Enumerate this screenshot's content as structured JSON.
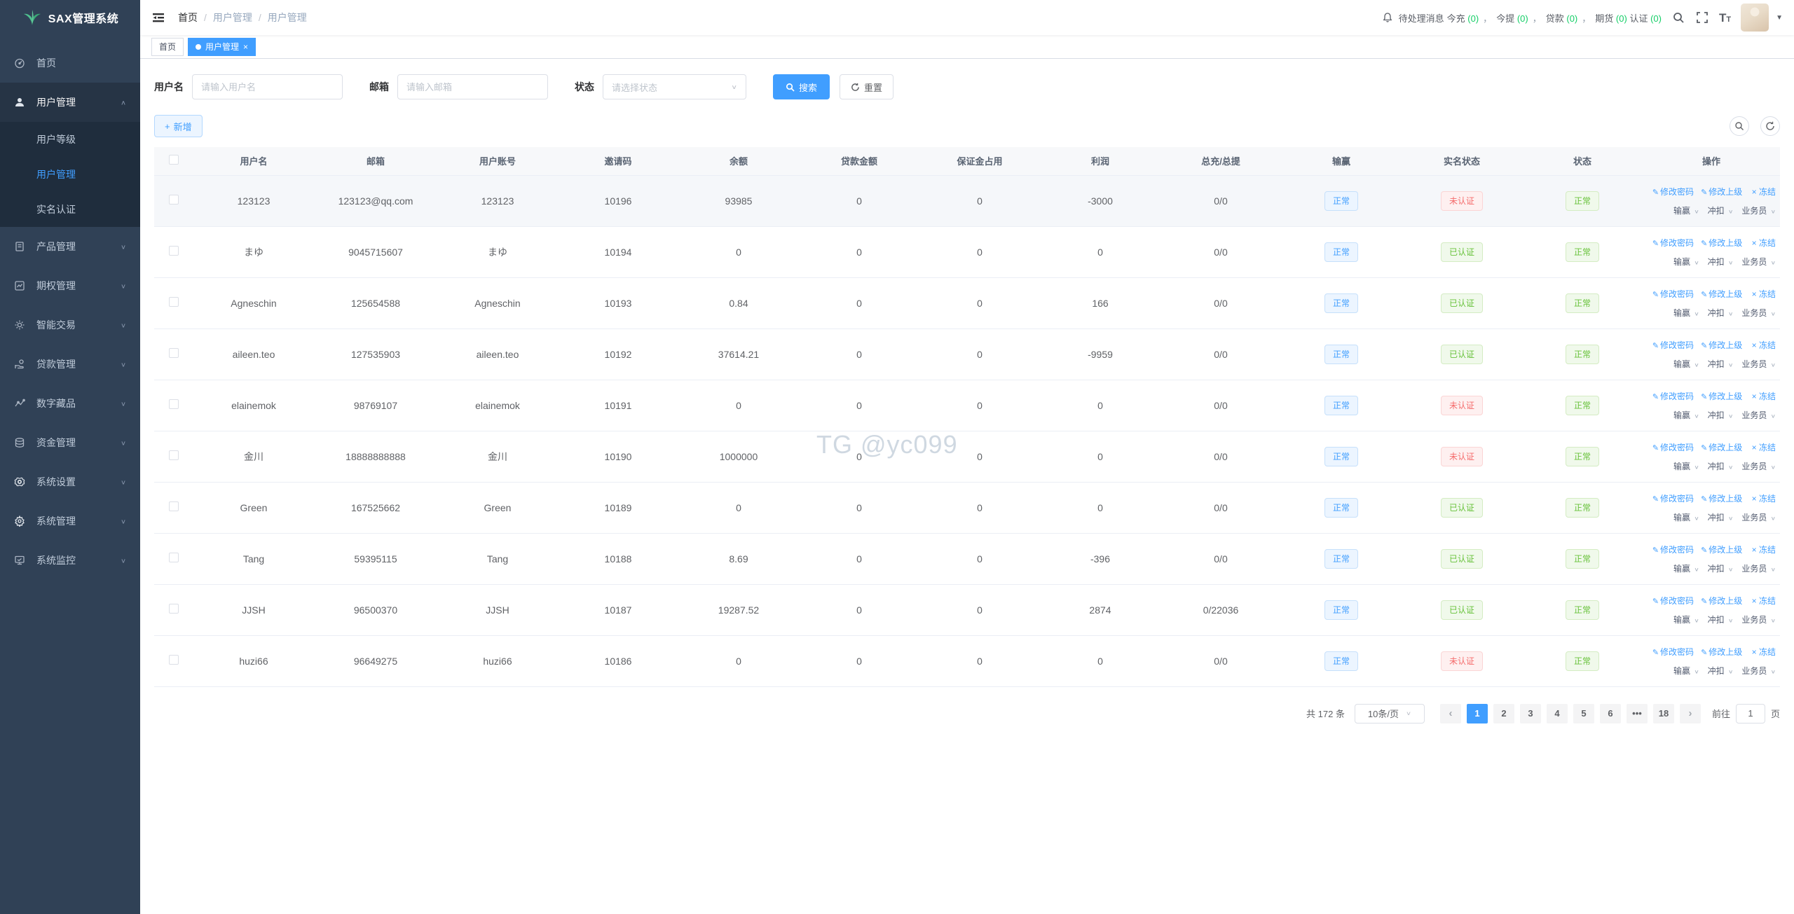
{
  "colors": {
    "accent": "#409eff",
    "success": "#67c23a",
    "count_green": "#13ce66",
    "danger": "#f56c6c",
    "sidebar_bg": "#304156",
    "submenu_bg": "#1f2d3d"
  },
  "app": {
    "logo_title": "SAX管理系统"
  },
  "sidebar": {
    "items": [
      {
        "label": "首页",
        "icon": "dashboard-icon"
      },
      {
        "label": "用户管理",
        "icon": "user-icon",
        "expanded": true,
        "children": [
          {
            "label": "用户等级"
          },
          {
            "label": "用户管理",
            "active": true
          },
          {
            "label": "实名认证"
          }
        ]
      },
      {
        "label": "产品管理",
        "icon": "product-icon"
      },
      {
        "label": "期权管理",
        "icon": "options-icon"
      },
      {
        "label": "智能交易",
        "icon": "smart-trade-icon"
      },
      {
        "label": "贷款管理",
        "icon": "loan-icon"
      },
      {
        "label": "数字藏品",
        "icon": "nft-icon"
      },
      {
        "label": "资金管理",
        "icon": "funds-icon"
      },
      {
        "label": "系统设置",
        "icon": "settings-icon"
      },
      {
        "label": "系统管理",
        "icon": "system-icon"
      },
      {
        "label": "系统监控",
        "icon": "monitor-icon"
      }
    ]
  },
  "header": {
    "breadcrumb": [
      "首页",
      "用户管理",
      "用户管理"
    ],
    "messages": {
      "prefix": "待处理消息",
      "items": [
        {
          "label": "今充",
          "count": "(0)",
          "sep": "，"
        },
        {
          "label": "今提",
          "count": "(0)",
          "sep": "，"
        },
        {
          "label": "贷款",
          "count": "(0)",
          "sep": "，"
        },
        {
          "label": "期货",
          "count": "(0)",
          "sep": ""
        },
        {
          "label": "认证",
          "count": "(0)",
          "sep": ""
        }
      ]
    }
  },
  "tabs": [
    {
      "label": "首页",
      "active": false,
      "closable": false
    },
    {
      "label": "用户管理",
      "active": true,
      "closable": true
    }
  ],
  "filters": {
    "username": {
      "label": "用户名",
      "placeholder": "请输入用户名",
      "value": ""
    },
    "email": {
      "label": "邮箱",
      "placeholder": "请输入邮箱",
      "value": ""
    },
    "status": {
      "label": "状态",
      "placeholder": "请选择状态"
    },
    "search_label": "搜索",
    "reset_label": "重置"
  },
  "toolbar": {
    "add_label": "新增"
  },
  "table": {
    "columns": [
      "用户名",
      "邮箱",
      "用户账号",
      "邀请码",
      "余额",
      "贷款金额",
      "保证金占用",
      "利润",
      "总充/总提",
      "输赢",
      "实名状态",
      "状态",
      "操作"
    ],
    "rows": [
      {
        "username": "123123",
        "email": "123123@qq.com",
        "account": "123123",
        "invite": "10196",
        "balance": "93985",
        "loan": "0",
        "margin": "0",
        "profit": "-3000",
        "total": "0/0",
        "winlose": "正常",
        "realname": "未认证",
        "realname_state": "danger",
        "status": "正常",
        "highlighted": true
      },
      {
        "username": "まゆ",
        "email": "9045715607",
        "account": "まゆ",
        "invite": "10194",
        "balance": "0",
        "loan": "0",
        "margin": "0",
        "profit": "0",
        "total": "0/0",
        "winlose": "正常",
        "realname": "已认证",
        "realname_state": "success",
        "status": "正常"
      },
      {
        "username": "Agneschin",
        "email": "125654588",
        "account": "Agneschin",
        "invite": "10193",
        "balance": "0.84",
        "loan": "0",
        "margin": "0",
        "profit": "166",
        "total": "0/0",
        "winlose": "正常",
        "realname": "已认证",
        "realname_state": "success",
        "status": "正常"
      },
      {
        "username": "aileen.teo",
        "email": "127535903",
        "account": "aileen.teo",
        "invite": "10192",
        "balance": "37614.21",
        "loan": "0",
        "margin": "0",
        "profit": "-9959",
        "total": "0/0",
        "winlose": "正常",
        "realname": "已认证",
        "realname_state": "success",
        "status": "正常"
      },
      {
        "username": "elainemok",
        "email": "98769107",
        "account": "elainemok",
        "invite": "10191",
        "balance": "0",
        "loan": "0",
        "margin": "0",
        "profit": "0",
        "total": "0/0",
        "winlose": "正常",
        "realname": "未认证",
        "realname_state": "danger",
        "status": "正常"
      },
      {
        "username": "金川",
        "email": "18888888888",
        "account": "金川",
        "invite": "10190",
        "balance": "1000000",
        "loan": "0",
        "margin": "0",
        "profit": "0",
        "total": "0/0",
        "winlose": "正常",
        "realname": "未认证",
        "realname_state": "danger",
        "status": "正常"
      },
      {
        "username": "Green",
        "email": "167525662",
        "account": "Green",
        "invite": "10189",
        "balance": "0",
        "loan": "0",
        "margin": "0",
        "profit": "0",
        "total": "0/0",
        "winlose": "正常",
        "realname": "已认证",
        "realname_state": "success",
        "status": "正常"
      },
      {
        "username": "Tang",
        "email": "59395115",
        "account": "Tang",
        "invite": "10188",
        "balance": "8.69",
        "loan": "0",
        "margin": "0",
        "profit": "-396",
        "total": "0/0",
        "winlose": "正常",
        "realname": "已认证",
        "realname_state": "success",
        "status": "正常"
      },
      {
        "username": "JJSH",
        "email": "96500370",
        "account": "JJSH",
        "invite": "10187",
        "balance": "19287.52",
        "loan": "0",
        "margin": "0",
        "profit": "2874",
        "total": "0/22036",
        "winlose": "正常",
        "realname": "已认证",
        "realname_state": "success",
        "status": "正常"
      },
      {
        "username": "huzi66",
        "email": "96649275",
        "account": "huzi66",
        "invite": "10186",
        "balance": "0",
        "loan": "0",
        "margin": "0",
        "profit": "0",
        "total": "0/0",
        "winlose": "正常",
        "realname": "未认证",
        "realname_state": "danger",
        "status": "正常"
      }
    ]
  },
  "row_actions": {
    "links": [
      "修改密码",
      "修改上级"
    ],
    "freeze_label": "冻结",
    "dropdowns": [
      "输赢",
      "冲扣",
      "业务员"
    ]
  },
  "pagination": {
    "total_label": "共 172 条",
    "page_size": "10条/页",
    "pages": [
      "1",
      "2",
      "3",
      "4",
      "5",
      "6",
      "•••",
      "18"
    ],
    "active_page": "1",
    "goto_label": "前往",
    "goto_value": "1",
    "goto_suffix": "页"
  },
  "watermark": "TG @yc099"
}
